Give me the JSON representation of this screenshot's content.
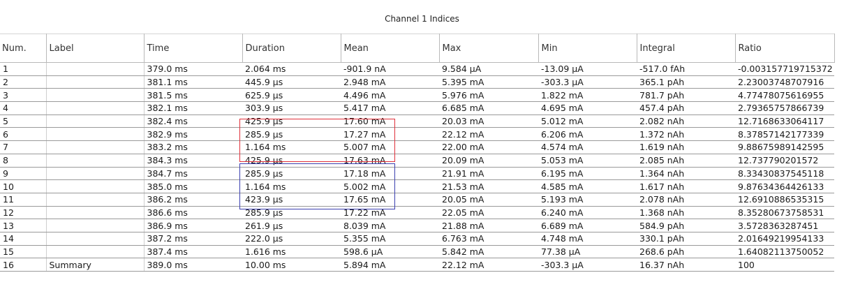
{
  "title": "Channel 1 Indices",
  "columns": [
    "Num.",
    "Label",
    "Time",
    "Duration",
    "Mean",
    "Max",
    "Min",
    "Integral",
    "Ratio"
  ],
  "rows": [
    [
      "1",
      "",
      "379.0 ms",
      "2.064 ms",
      "-901.9 nA",
      "9.584 µA",
      "-13.09 µA",
      "-517.0 fAh",
      "-0.003157719715372"
    ],
    [
      "2",
      "",
      "381.1 ms",
      "445.9 µs",
      "2.948 mA",
      "5.395 mA",
      "-303.3 µA",
      "365.1 pAh",
      "2.23003748707916"
    ],
    [
      "3",
      "",
      "381.5 ms",
      "625.9 µs",
      "4.496 mA",
      "5.976 mA",
      "1.822 mA",
      "781.7 pAh",
      "4.77478075616955"
    ],
    [
      "4",
      "",
      "382.1 ms",
      "303.9 µs",
      "5.417 mA",
      "6.685 mA",
      "4.695 mA",
      "457.4 pAh",
      "2.79365757866739"
    ],
    [
      "5",
      "",
      "382.4 ms",
      "425.9 µs",
      "17.60 mA",
      "20.03 mA",
      "5.012 mA",
      "2.082 nAh",
      "12.7168633064117"
    ],
    [
      "6",
      "",
      "382.9 ms",
      "285.9 µs",
      "17.27 mA",
      "22.12 mA",
      "6.206 mA",
      "1.372 nAh",
      "8.37857142177339"
    ],
    [
      "7",
      "",
      "383.2 ms",
      "1.164 ms",
      "5.007 mA",
      "22.00 mA",
      "4.574 mA",
      "1.619 nAh",
      "9.88675989142595"
    ],
    [
      "8",
      "",
      "384.3 ms",
      "425.9 µs",
      "17.63 mA",
      "20.09 mA",
      "5.053 mA",
      "2.085 nAh",
      "12.737790201572"
    ],
    [
      "9",
      "",
      "384.7 ms",
      "285.9 µs",
      "17.18 mA",
      "21.91 mA",
      "6.195 mA",
      "1.364 nAh",
      "8.33430837545118"
    ],
    [
      "10",
      "",
      "385.0 ms",
      "1.164 ms",
      "5.002 mA",
      "21.53 mA",
      "4.585 mA",
      "1.617 nAh",
      "9.87634364426133"
    ],
    [
      "11",
      "",
      "386.2 ms",
      "423.9 µs",
      "17.65 mA",
      "20.05 mA",
      "5.193 mA",
      "2.078 nAh",
      "12.6910886535315"
    ],
    [
      "12",
      "",
      "386.6 ms",
      "285.9 µs",
      "17.22 mA",
      "22.05 mA",
      "6.240 mA",
      "1.368 nAh",
      "8.35280673758531"
    ],
    [
      "13",
      "",
      "386.9 ms",
      "261.9 µs",
      "8.039 mA",
      "21.88 mA",
      "6.689 mA",
      "584.9 pAh",
      "3.5728363287451"
    ],
    [
      "14",
      "",
      "387.2 ms",
      "222.0 µs",
      "5.355 mA",
      "6.763 mA",
      "4.748 mA",
      "330.1 pAh",
      "2.01649219954133"
    ],
    [
      "15",
      "",
      "387.4 ms",
      "1.616 ms",
      "598.6 µA",
      "5.842 mA",
      "77.38 µA",
      "268.6 pAh",
      "1.64082113750052"
    ],
    [
      "16",
      "Summary",
      "389.0 ms",
      "10.00 ms",
      "5.894 mA",
      "22.12 mA",
      "-303.3 µA",
      "16.37 nAh",
      "100"
    ]
  ],
  "highlights": [
    {
      "name": "red",
      "color": "#e0303a",
      "rows": [
        "5",
        "7"
      ],
      "columns": [
        "Duration",
        "Mean"
      ]
    },
    {
      "name": "blue",
      "color": "#3b3fb0",
      "rows": [
        "8",
        "10"
      ],
      "columns": [
        "Duration",
        "Mean"
      ]
    }
  ]
}
